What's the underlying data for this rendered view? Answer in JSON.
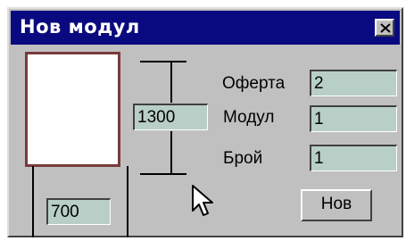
{
  "window": {
    "title": "Нов модул",
    "close_icon": "close-x-icon"
  },
  "dimensions": {
    "height_value": "1300",
    "width_value": "700"
  },
  "form": {
    "offer_label": "Оферта",
    "offer_value": "2",
    "module_label": "Модул",
    "module_value": "1",
    "count_label": "Брой",
    "count_value": "1"
  },
  "actions": {
    "new_label": "Нов"
  },
  "cursor_icon": "mouse-pointer-icon",
  "colors": {
    "titlebar": "#0a0a80",
    "window": "#c0c0c0",
    "field": "#b8cfc8",
    "preview_border": "#7a3a3a"
  }
}
